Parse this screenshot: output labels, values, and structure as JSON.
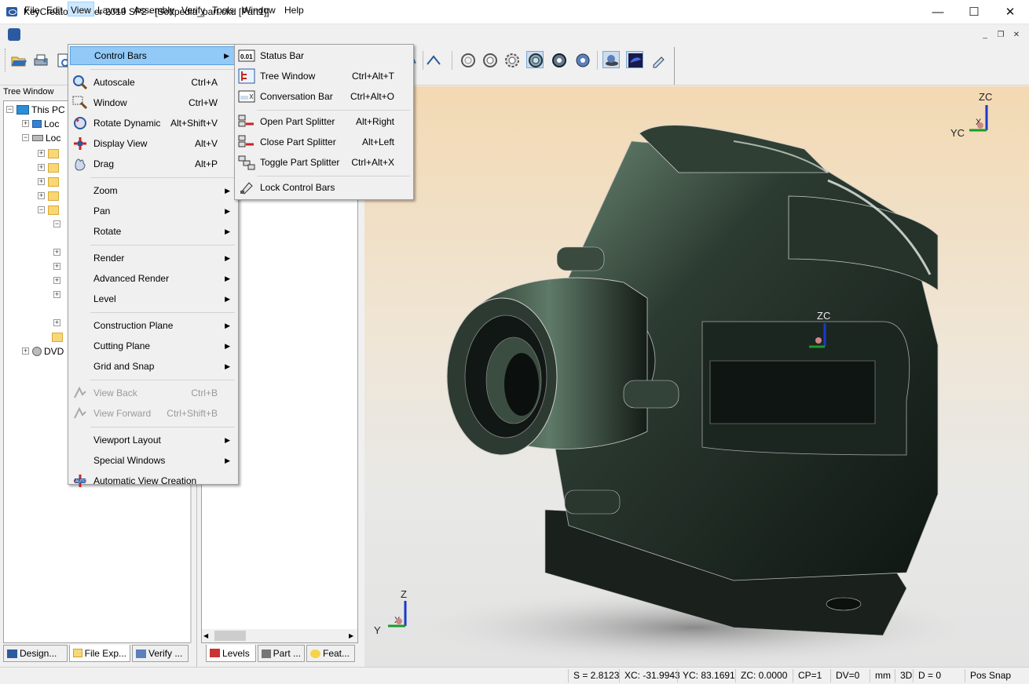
{
  "window": {
    "title": "KeyCreator Viewer 2019 SP2 - [Softpedia_part.ckd [Part1]]",
    "minimize": "—",
    "maximize": "☐",
    "close": "✕"
  },
  "menubar": {
    "items": [
      "File",
      "Edit",
      "View",
      "Layout",
      "Assembly",
      "Verify",
      "Tools",
      "Window",
      "Help"
    ],
    "active": "View",
    "mdi": [
      "_",
      "❐",
      "✕"
    ]
  },
  "tree": {
    "title": "Tree Window",
    "rows": [
      {
        "label": "This PC",
        "exp": "−"
      },
      {
        "label": "Loc",
        "exp": "+"
      },
      {
        "label": "Loc",
        "exp": "−"
      },
      {
        "label": "",
        "exp": "+"
      },
      {
        "label": "",
        "exp": "+"
      },
      {
        "label": "",
        "exp": "+"
      },
      {
        "label": "",
        "exp": "+"
      },
      {
        "label": "",
        "exp": "−"
      },
      {
        "label": "",
        "exp": "−"
      },
      {
        "label": "",
        "exp": "+"
      },
      {
        "label": "",
        "exp": "+"
      },
      {
        "label": "",
        "exp": "+"
      },
      {
        "label": "",
        "exp": "+"
      },
      {
        "label": "",
        "exp": "+"
      },
      {
        "label": "DVD",
        "exp": "+"
      }
    ]
  },
  "left_tabs": [
    "Design...",
    "File Exp...",
    "Verify ..."
  ],
  "mid_tabs": [
    "Levels",
    "Part ...",
    "Feat..."
  ],
  "view_menu": {
    "items": [
      {
        "label": "Control Bars",
        "shortcut": "",
        "submenu": true,
        "highlight": true,
        "icon": ""
      },
      {
        "sep": true
      },
      {
        "label": "Autoscale",
        "shortcut": "Ctrl+A",
        "icon": "autoscale-icon"
      },
      {
        "label": "Window",
        "shortcut": "Ctrl+W",
        "icon": "zoom-window-icon"
      },
      {
        "label": "Rotate Dynamic",
        "shortcut": "Alt+Shift+V",
        "icon": "rotate-dynamic-icon"
      },
      {
        "label": "Display View",
        "shortcut": "Alt+V",
        "icon": "display-view-icon"
      },
      {
        "label": "Drag",
        "shortcut": "Alt+P",
        "icon": "drag-hand-icon"
      },
      {
        "sep": true
      },
      {
        "label": "Zoom",
        "submenu": true
      },
      {
        "label": "Pan",
        "submenu": true
      },
      {
        "label": "Rotate",
        "submenu": true
      },
      {
        "sep": true
      },
      {
        "label": "Render",
        "submenu": true
      },
      {
        "label": "Advanced Render",
        "submenu": true
      },
      {
        "label": "Level",
        "submenu": true
      },
      {
        "sep": true
      },
      {
        "label": "Construction Plane",
        "submenu": true
      },
      {
        "label": "Cutting Plane",
        "submenu": true
      },
      {
        "label": "Grid and Snap",
        "submenu": true
      },
      {
        "sep": true
      },
      {
        "label": "View Back",
        "shortcut": "Ctrl+B",
        "disabled": true,
        "icon": "view-back-icon"
      },
      {
        "label": "View Forward",
        "shortcut": "Ctrl+Shift+B",
        "disabled": true,
        "icon": "view-forward-icon"
      },
      {
        "sep": true
      },
      {
        "label": "Viewport Layout",
        "submenu": true
      },
      {
        "label": "Special Windows",
        "submenu": true
      },
      {
        "label": "Automatic View Creation",
        "icon": "auto-view-icon"
      }
    ]
  },
  "control_bars_menu": {
    "items": [
      {
        "label": "Status Bar",
        "shortcut": "",
        "icon": "status-bar-icon",
        "icon_text": "0.01"
      },
      {
        "label": "Tree Window",
        "shortcut": "Ctrl+Alt+T",
        "icon": "tree-window-icon"
      },
      {
        "label": "Conversation Bar",
        "shortcut": "Ctrl+Alt+O",
        "icon": "conversation-bar-icon"
      },
      {
        "sep": true
      },
      {
        "label": "Open Part Splitter",
        "shortcut": "Alt+Right",
        "icon": "open-splitter-icon"
      },
      {
        "label": "Close Part Splitter",
        "shortcut": "Alt+Left",
        "icon": "close-splitter-icon"
      },
      {
        "label": "Toggle Part Splitter",
        "shortcut": "Ctrl+Alt+X",
        "icon": "toggle-splitter-icon"
      },
      {
        "sep": true
      },
      {
        "label": "Lock Control Bars",
        "shortcut": "",
        "icon": "lock-bars-icon"
      }
    ]
  },
  "viewport": {
    "triad_top": {
      "z": "ZC",
      "y": "YC",
      "x": "X"
    },
    "triad_center": {
      "z": "ZC"
    },
    "triad_bottom": {
      "z": "Z",
      "y": "Y",
      "x": "X"
    }
  },
  "status": [
    "S = 2.8123",
    "XC: -31.9943",
    "YC: 83.1691",
    "ZC: 0.0000",
    "CP=1",
    "DV=0",
    "mm",
    "3D",
    "D = 0",
    "Pos Snap"
  ],
  "colors": {
    "menu_highlight": "#91c9f7",
    "part": "#1f2a22"
  }
}
